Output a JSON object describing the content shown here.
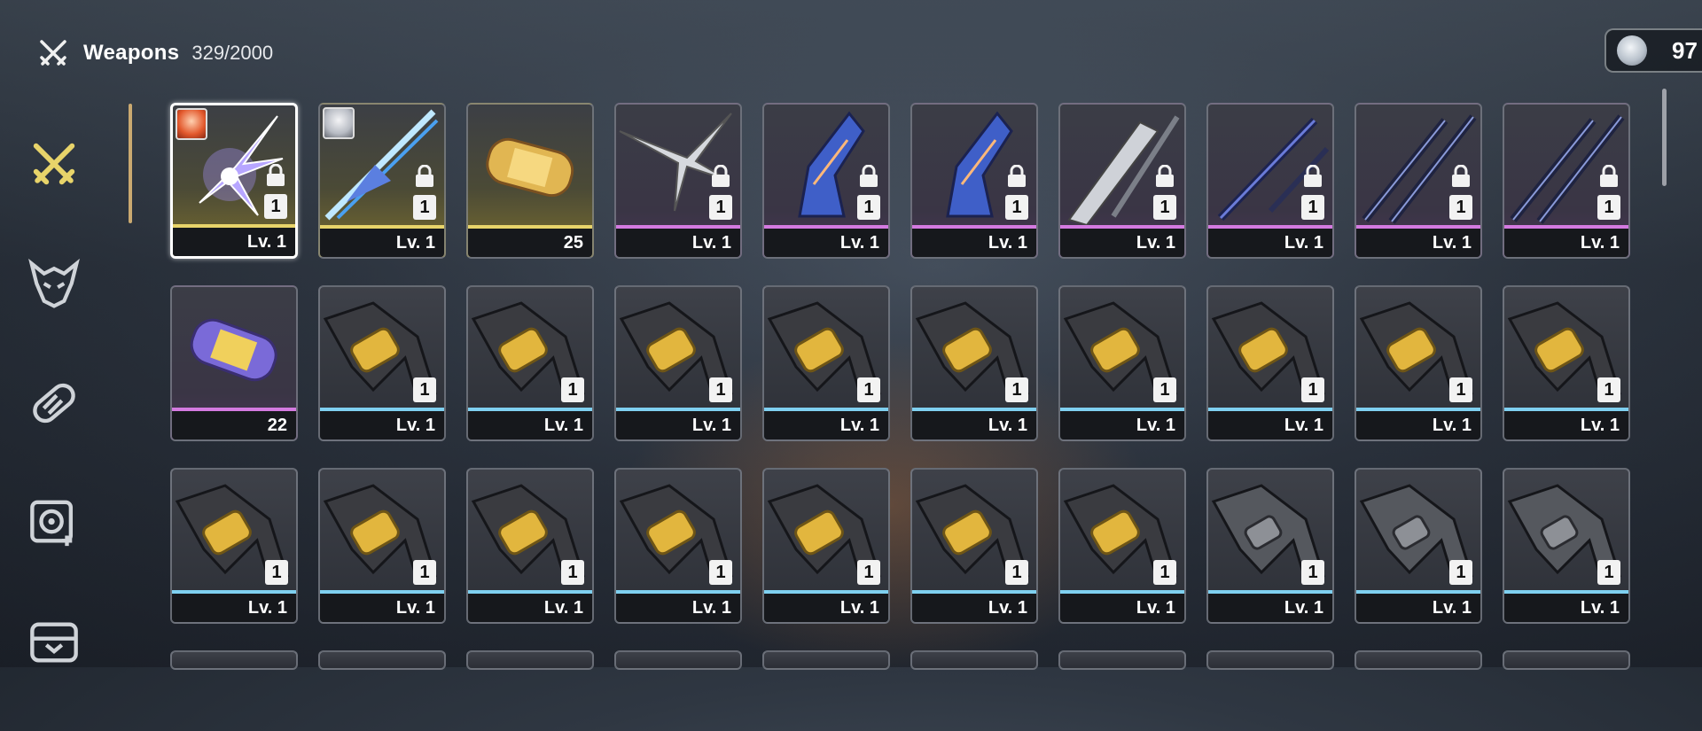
{
  "header": {
    "title": "Weapons",
    "count": "329/2000",
    "icon": "crossed-swords-icon"
  },
  "currency": {
    "amount": "97",
    "icon": "coin-icon"
  },
  "sidebar": {
    "items": [
      {
        "name": "weapons",
        "icon": "crossed-swords-icon",
        "active": true
      },
      {
        "name": "echoes",
        "icon": "demon-mask-icon",
        "active": false
      },
      {
        "name": "materials",
        "icon": "capsule-icon",
        "active": false
      },
      {
        "name": "devices",
        "icon": "device-icon",
        "active": false
      },
      {
        "name": "supplies",
        "icon": "chest-icon",
        "active": false
      }
    ]
  },
  "colors": {
    "gold": "#e8d46a",
    "purple": "#d47ae0",
    "blue": "#7fd0f0",
    "accent": "#caa970"
  },
  "rows": [
    [
      {
        "footer": "Lv. 1",
        "qty": "1",
        "rarity": "gold",
        "locked": true,
        "avatar": "orange",
        "art": "purple-crystal-weapon",
        "selected": true
      },
      {
        "footer": "Lv. 1",
        "qty": "1",
        "rarity": "gold",
        "locked": true,
        "avatar": "white",
        "art": "blue-spear"
      },
      {
        "footer": "25",
        "qty": "",
        "rarity": "gold",
        "locked": false,
        "art": "gold-capsule"
      },
      {
        "footer": "Lv. 1",
        "qty": "1",
        "rarity": "purple",
        "locked": true,
        "art": "silver-pinwheel"
      },
      {
        "footer": "Lv. 1",
        "qty": "1",
        "rarity": "purple",
        "locked": true,
        "art": "blue-gauntlet"
      },
      {
        "footer": "Lv. 1",
        "qty": "1",
        "rarity": "purple",
        "locked": true,
        "art": "blue-gauntlet"
      },
      {
        "footer": "Lv. 1",
        "qty": "1",
        "rarity": "purple",
        "locked": true,
        "art": "silver-blade"
      },
      {
        "footer": "Lv. 1",
        "qty": "1",
        "rarity": "purple",
        "locked": true,
        "art": "dark-sword"
      },
      {
        "footer": "Lv. 1",
        "qty": "1",
        "rarity": "purple",
        "locked": true,
        "art": "twin-staff"
      },
      {
        "footer": "Lv. 1",
        "qty": "1",
        "rarity": "purple",
        "locked": true,
        "art": "twin-staff"
      }
    ],
    [
      {
        "footer": "22",
        "qty": "",
        "rarity": "purple",
        "locked": false,
        "art": "purple-capsule"
      },
      {
        "footer": "Lv. 1",
        "qty": "1",
        "rarity": "blue",
        "locked": false,
        "art": "yellow-gauntlet"
      },
      {
        "footer": "Lv. 1",
        "qty": "1",
        "rarity": "blue",
        "locked": false,
        "art": "yellow-gauntlet"
      },
      {
        "footer": "Lv. 1",
        "qty": "1",
        "rarity": "blue",
        "locked": false,
        "art": "yellow-gauntlet"
      },
      {
        "footer": "Lv. 1",
        "qty": "1",
        "rarity": "blue",
        "locked": false,
        "art": "yellow-gauntlet"
      },
      {
        "footer": "Lv. 1",
        "qty": "1",
        "rarity": "blue",
        "locked": false,
        "art": "yellow-gauntlet"
      },
      {
        "footer": "Lv. 1",
        "qty": "1",
        "rarity": "blue",
        "locked": false,
        "art": "yellow-gauntlet"
      },
      {
        "footer": "Lv. 1",
        "qty": "1",
        "rarity": "blue",
        "locked": false,
        "art": "yellow-gauntlet"
      },
      {
        "footer": "Lv. 1",
        "qty": "1",
        "rarity": "blue",
        "locked": false,
        "art": "yellow-gauntlet"
      },
      {
        "footer": "Lv. 1",
        "qty": "1",
        "rarity": "blue",
        "locked": false,
        "art": "yellow-gauntlet"
      }
    ],
    [
      {
        "footer": "Lv. 1",
        "qty": "1",
        "rarity": "blue",
        "locked": false,
        "art": "yellow-gauntlet"
      },
      {
        "footer": "Lv. 1",
        "qty": "1",
        "rarity": "blue",
        "locked": false,
        "art": "yellow-gauntlet"
      },
      {
        "footer": "Lv. 1",
        "qty": "1",
        "rarity": "blue",
        "locked": false,
        "art": "yellow-gauntlet"
      },
      {
        "footer": "Lv. 1",
        "qty": "1",
        "rarity": "blue",
        "locked": false,
        "art": "yellow-gauntlet"
      },
      {
        "footer": "Lv. 1",
        "qty": "1",
        "rarity": "blue",
        "locked": false,
        "art": "yellow-gauntlet"
      },
      {
        "footer": "Lv. 1",
        "qty": "1",
        "rarity": "blue",
        "locked": false,
        "art": "yellow-gauntlet"
      },
      {
        "footer": "Lv. 1",
        "qty": "1",
        "rarity": "blue",
        "locked": false,
        "art": "yellow-gauntlet"
      },
      {
        "footer": "Lv. 1",
        "qty": "1",
        "rarity": "blue",
        "locked": false,
        "art": "gray-gauntlet"
      },
      {
        "footer": "Lv. 1",
        "qty": "1",
        "rarity": "blue",
        "locked": false,
        "art": "gray-gauntlet"
      },
      {
        "footer": "Lv. 1",
        "qty": "1",
        "rarity": "blue",
        "locked": false,
        "art": "gray-gauntlet"
      }
    ]
  ]
}
